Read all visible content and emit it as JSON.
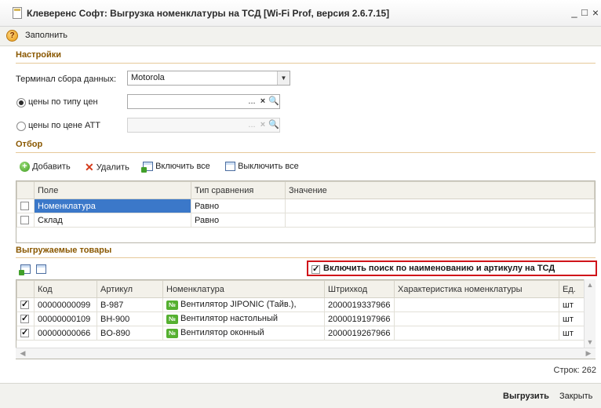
{
  "window": {
    "title": "Клеверенс Софт: Выгрузка номенклатуры на ТСД [Wi-Fi Prof, версия 2.6.7.15]",
    "minimize": "_",
    "maximize": "□",
    "close": "×"
  },
  "commandbar": {
    "help_glyph": "?",
    "fill_label": "Заполнить"
  },
  "settings": {
    "title": "Настройки",
    "terminal_label": "Терминал сбора данных:",
    "terminal_value": "Motorola",
    "price_by_type_label": "цены по типу цен",
    "price_by_type_selected": true,
    "price_by_att_label": "цены по цене АТТ",
    "price_by_att_selected": false,
    "field_buttons": {
      "dots": "...",
      "clear": "×",
      "search": "🔍"
    }
  },
  "filter": {
    "title": "Отбор",
    "toolbar": {
      "add": "Добавить",
      "delete": "Удалить",
      "enable_all": "Включить все",
      "disable_all": "Выключить все"
    },
    "columns": [
      "Поле",
      "Тип сравнения",
      "Значение"
    ],
    "rows": [
      {
        "checked": false,
        "field": "Номенклатура",
        "comparison": "Равно",
        "value": ""
      },
      {
        "checked": false,
        "field": "Склад",
        "comparison": "Равно",
        "value": ""
      }
    ]
  },
  "goods": {
    "title": "Выгружаемые товары",
    "search_checkbox_label": "Включить поиск по наименованию и артикулу на ТСД",
    "search_checkbox_checked": true,
    "columns": [
      "Код",
      "Артикул",
      "Номенклатура",
      "Штрихкод",
      "Характеристика номенклатуры",
      "Ед."
    ],
    "item_icon_text": "№",
    "rows": [
      {
        "checked": true,
        "code": "00000000099",
        "article": "B-987",
        "name": "Вентилятор JIPONIC (Тайв.),",
        "barcode": "2000019337966",
        "characteristic": "",
        "unit": "шт"
      },
      {
        "checked": true,
        "code": "00000000109",
        "article": "BH-900",
        "name": "Вентилятор настольный",
        "barcode": "2000019197966",
        "characteristic": "",
        "unit": "шт"
      },
      {
        "checked": true,
        "code": "00000000066",
        "article": "BO-890",
        "name": "Вентилятор оконный",
        "barcode": "2000019267966",
        "characteristic": "",
        "unit": "шт"
      }
    ],
    "row_count_label": "Строк: 262"
  },
  "footer": {
    "upload_label": "Выгрузить",
    "close_label": "Закрыть"
  },
  "colors": {
    "section_title": "#8a5800",
    "selection": "#3b78c9",
    "highlight_border": "#d0141a"
  }
}
